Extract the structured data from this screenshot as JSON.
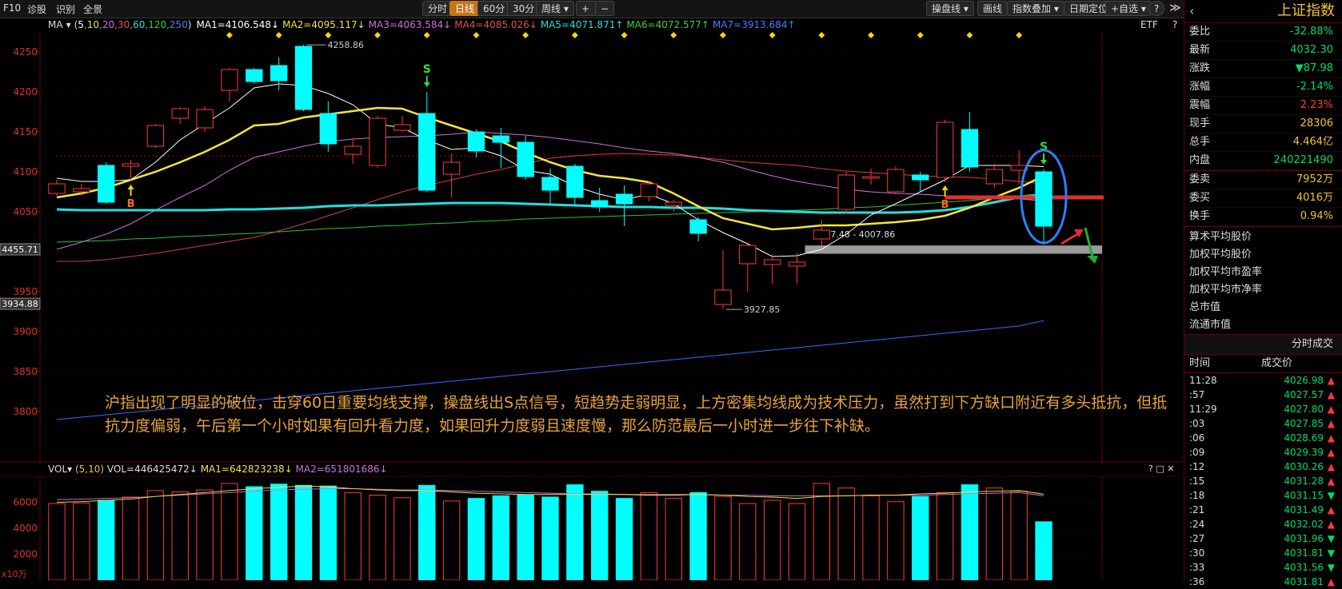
{
  "topbar": {
    "left_items": [
      "F10",
      "诊股",
      "识别",
      "全景"
    ],
    "period_buttons": [
      "分时",
      "日线",
      "60分",
      "30分",
      "周线 ▾"
    ],
    "active_period": "日线",
    "zoom_in": "+",
    "zoom_out": "−",
    "right_buttons": [
      "操盘线 ▾",
      "画线",
      "指数叠加 ▾",
      "日期定位",
      "+自选 ▾"
    ],
    "help": "?",
    "collapse": "≫"
  },
  "ma_info": {
    "label": "MA",
    "params_open": "(",
    "params": [
      "5",
      "10",
      "20",
      "30",
      "60",
      "120",
      "250"
    ],
    "params_close": ")",
    "items": [
      {
        "text": "MA1=4106.548↓",
        "color": "#ffffff"
      },
      {
        "text": "MA2=4095.117↓",
        "color": "#f1e33a"
      },
      {
        "text": "MA3=4063.584↓",
        "color": "#d070e0"
      },
      {
        "text": "MA4=4085.026↓",
        "color": "#e05050"
      },
      {
        "text": "MA5=4071.871↑",
        "color": "#20e0e0"
      },
      {
        "text": "MA6=4072.577↑",
        "color": "#40d040"
      },
      {
        "text": "MA7=3913.684↑",
        "color": "#4080ff"
      }
    ],
    "etf": "ETF",
    "help": "?"
  },
  "colors": {
    "up": "#ff3a3a",
    "down": "#00ffff",
    "ma5": "#ffffff",
    "ma10": "#f5e63a",
    "ma20": "#d070e0",
    "ma30": "#d04040",
    "ma60": "#20e0e0",
    "ma120": "#30c030",
    "ma250": "#2f6fff",
    "grid": "#500000",
    "annotation": "#e8a33a",
    "price_up": "#ff3a3a",
    "price_down": "#00dd66"
  },
  "chart_data": [
    {
      "type": "candlestick",
      "yticks": [
        3800,
        3850,
        3900,
        3950,
        4000,
        4050,
        4100,
        4150,
        4200,
        4250
      ],
      "ylim": [
        3775,
        4275
      ],
      "left_markers": [
        "4455.71",
        "3934.88"
      ],
      "candles": [
        {
          "o": 4073,
          "c": 4085,
          "h": 4090,
          "l": 4070
        },
        {
          "o": 4075,
          "c": 4079,
          "h": 4085,
          "l": 4070
        },
        {
          "o": 4108,
          "c": 4062,
          "h": 4112,
          "l": 4060
        },
        {
          "o": 4107,
          "c": 4110,
          "h": 4115,
          "l": 4088
        },
        {
          "o": 4132,
          "c": 4158,
          "h": 4160,
          "l": 4130
        },
        {
          "o": 4167,
          "c": 4179,
          "h": 4181,
          "l": 4160
        },
        {
          "o": 4155,
          "c": 4178,
          "h": 4182,
          "l": 4150
        },
        {
          "o": 4202,
          "c": 4228,
          "h": 4230,
          "l": 4188
        },
        {
          "o": 4228,
          "c": 4213,
          "h": 4230,
          "l": 4210
        },
        {
          "o": 4233,
          "c": 4214,
          "h": 4243,
          "l": 4202
        },
        {
          "o": 4257,
          "c": 4178,
          "h": 4258.86,
          "l": 4176
        },
        {
          "o": 4173,
          "c": 4135,
          "h": 4188,
          "l": 4125
        },
        {
          "o": 4122,
          "c": 4132,
          "h": 4142,
          "l": 4110
        },
        {
          "o": 4108,
          "c": 4167,
          "h": 4170,
          "l": 4105
        },
        {
          "o": 4152,
          "c": 4159,
          "h": 4170,
          "l": 4150
        },
        {
          "o": 4173,
          "c": 4077,
          "h": 4200,
          "l": 4075
        },
        {
          "o": 4097,
          "c": 4112,
          "h": 4123,
          "l": 4068
        },
        {
          "o": 4150,
          "c": 4126,
          "h": 4153,
          "l": 4118
        },
        {
          "o": 4145,
          "c": 4137,
          "h": 4155,
          "l": 4105
        },
        {
          "o": 4137,
          "c": 4094,
          "h": 4145,
          "l": 4090
        },
        {
          "o": 4093,
          "c": 4077,
          "h": 4104,
          "l": 4060
        },
        {
          "o": 4107,
          "c": 4068,
          "h": 4110,
          "l": 4058
        },
        {
          "o": 4064,
          "c": 4056,
          "h": 4080,
          "l": 4050
        },
        {
          "o": 4072,
          "c": 4060,
          "h": 4083,
          "l": 4032
        },
        {
          "o": 4069,
          "c": 4085,
          "h": 4088,
          "l": 4063
        },
        {
          "o": 4058,
          "c": 4062,
          "h": 4065,
          "l": 4050
        },
        {
          "o": 4040,
          "c": 4023,
          "h": 4043,
          "l": 4013
        },
        {
          "o": 3934,
          "c": 3952,
          "h": 4002,
          "l": 3927.85
        },
        {
          "o": 3985,
          "c": 4008,
          "h": 4010,
          "l": 3950
        },
        {
          "o": 3984,
          "c": 3990,
          "h": 3997,
          "l": 3960
        },
        {
          "o": 3982,
          "c": 3987,
          "h": 3998,
          "l": 3960
        },
        {
          "o": 4016,
          "c": 4027,
          "h": 4040,
          "l": 4007
        },
        {
          "o": 4053,
          "c": 4096,
          "h": 4100,
          "l": 4048
        },
        {
          "o": 4092,
          "c": 4094,
          "h": 4104,
          "l": 4084
        },
        {
          "o": 4075,
          "c": 4103,
          "h": 4107,
          "l": 4072
        },
        {
          "o": 4096,
          "c": 4090,
          "h": 4100,
          "l": 4075
        },
        {
          "o": 4093,
          "c": 4162,
          "h": 4165,
          "l": 4087
        },
        {
          "o": 4153,
          "c": 4106,
          "h": 4175,
          "l": 4100
        },
        {
          "o": 4085,
          "c": 4103,
          "h": 4110,
          "l": 4080
        },
        {
          "o": 4102,
          "c": 4108,
          "h": 4127,
          "l": 4085
        },
        {
          "o": 4100,
          "c": 4032,
          "h": 4103,
          "l": 4009
        }
      ],
      "ma10": [
        4068,
        4073,
        4080,
        4090,
        4100,
        4112,
        4125,
        4140,
        4158,
        4160,
        4168,
        4172,
        4176,
        4180,
        4179,
        4168,
        4158,
        4148,
        4138,
        4124,
        4112,
        4102,
        4095,
        4092,
        4087,
        4073,
        4057,
        4042,
        4035,
        4028,
        4030,
        4033,
        4033,
        4035,
        4037,
        4040,
        4045,
        4055,
        4068,
        4080,
        4095
      ],
      "ma5": [
        4092,
        4088,
        4088,
        4090,
        4112,
        4140,
        4160,
        4180,
        4205,
        4210,
        4208,
        4198,
        4184,
        4160,
        4155,
        4140,
        4128,
        4130,
        4120,
        4102,
        4097,
        4082,
        4072,
        4065,
        4072,
        4060,
        4040,
        4024,
        4010,
        3994,
        3995,
        4003,
        4022,
        4046,
        4060,
        4075,
        4090,
        4108,
        4108,
        4108,
        4106.5
      ],
      "ma20": [
        4003,
        4012,
        4022,
        4035,
        4052,
        4068,
        4083,
        4102,
        4118,
        4125,
        4132,
        4138,
        4141,
        4143,
        4144,
        4145,
        4147,
        4150,
        4148,
        4146,
        4143,
        4139,
        4135,
        4130,
        4126,
        4123,
        4118,
        4112,
        4103,
        4095,
        4088,
        4083,
        4078,
        4075,
        4073,
        4072,
        4070,
        4069,
        4068,
        4066,
        4063.6
      ],
      "ma30": [
        3988,
        3988,
        3990,
        3994,
        3998,
        4003,
        4008,
        4013,
        4018,
        4026,
        4035,
        4045,
        4055,
        4065,
        4075,
        4083,
        4090,
        4097,
        4103,
        4110,
        4117,
        4120,
        4122,
        4123,
        4122,
        4121,
        4118,
        4115,
        4112,
        4110,
        4108,
        4104,
        4101,
        4099,
        4097,
        4095,
        4094,
        4093,
        4091,
        4088,
        4085
      ],
      "ma60": [
        4053,
        4052,
        4052,
        4052,
        4052,
        4052,
        4052,
        4053,
        4053,
        4054,
        4055,
        4057,
        4058,
        4058,
        4059,
        4060,
        4061,
        4061,
        4061,
        4060,
        4059,
        4058,
        4057,
        4056,
        4056,
        4055,
        4055,
        4054,
        4052,
        4051,
        4050,
        4049,
        4049,
        4049,
        4049,
        4050,
        4052,
        4056,
        4062,
        4068,
        4072
      ],
      "ma120": [
        4012,
        4013,
        4014,
        4016,
        4017,
        4019,
        4020,
        4022,
        4023,
        4025,
        4027,
        4029,
        4030,
        4032,
        4033,
        4035,
        4036,
        4038,
        4039,
        4041,
        4042,
        4043,
        4044,
        4045,
        4046,
        4047,
        4048,
        4049,
        4050,
        4051,
        4052,
        4053,
        4055,
        4056,
        4058,
        4060,
        4062,
        4064,
        4067,
        4070,
        4072.6
      ],
      "ma250": [
        3790,
        3793,
        3796,
        3799,
        3802,
        3805,
        3808,
        3811,
        3814,
        3817,
        3820,
        3823,
        3826,
        3829,
        3832,
        3835,
        3838,
        3841,
        3844,
        3847,
        3850,
        3853,
        3856,
        3859,
        3862,
        3865,
        3868,
        3871,
        3874,
        3877,
        3880,
        3883,
        3886,
        3889,
        3892,
        3895,
        3898,
        3901,
        3904,
        3907,
        3913.7
      ],
      "annotations": {
        "high_label": "4258.86",
        "low_label": "3927.85",
        "gap_label": "3997.48 - 4007.86",
        "gap_range": [
          3997.48,
          4007.86
        ],
        "resistance_level": 4068,
        "b_signals": [
          3,
          36
        ],
        "s_signals": [
          15,
          40
        ],
        "b_text": "B",
        "s_text": "S"
      }
    },
    {
      "type": "bar",
      "name": "VOL",
      "yticks": [
        2000,
        4000,
        6000
      ],
      "unit_label": "x10万",
      "ylim": [
        0,
        8000
      ],
      "values": [
        5900,
        5950,
        6150,
        6400,
        6900,
        6800,
        6950,
        7450,
        7200,
        7400,
        7300,
        7250,
        6750,
        6550,
        6350,
        7300,
        6100,
        6300,
        6500,
        6550,
        6400,
        7350,
        6850,
        6300,
        6750,
        6300,
        6750,
        6450,
        5900,
        6150,
        5900,
        7450,
        7100,
        6500,
        6050,
        6450,
        6750,
        7350,
        7100,
        6850,
        4500
      ],
      "ma1": [
        6000,
        6050,
        6150,
        6250,
        6450,
        6600,
        6750,
        6900,
        7050,
        7150,
        7250,
        7200,
        7050,
        6950,
        6900,
        6900,
        6800,
        6700,
        6650,
        6600,
        6600,
        6600,
        6600,
        6600,
        6550,
        6550,
        6600,
        6550,
        6450,
        6400,
        6300,
        6450,
        6500,
        6550,
        6550,
        6650,
        6700,
        6800,
        6850,
        6900,
        6620
      ],
      "ma2": [
        6200,
        6250,
        6300,
        6350,
        6450,
        6550,
        6650,
        6750,
        6850,
        6950,
        7000,
        7050,
        7050,
        7000,
        6950,
        6950,
        6900,
        6850,
        6800,
        6750,
        6700,
        6650,
        6650,
        6600,
        6600,
        6600,
        6600,
        6550,
        6550,
        6500,
        6500,
        6500,
        6500,
        6550,
        6550,
        6550,
        6600,
        6650,
        6700,
        6750,
        6500
      ]
    }
  ],
  "vol_info": {
    "label": "VOL",
    "params": "(5,10)",
    "vol": "VOL=446425472↓",
    "ma1": "MA1=642823238↓",
    "ma2": "MA2=651801686↓",
    "icons": "? □ ✕"
  },
  "annotation_text": "沪指出现了明显的破位，击穿60日重要均线支撑，操盘线出S点信号，短趋势走弱明显，上方密集均线成为技术压力，虽然打到下方缺口附近有多头抵抗，但抵抗力度偏弱，午后第一个小时如果有回升看力度，如果回升力度弱且速度慢，那么防范最后一小时进一步往下补缺。",
  "rpanel": {
    "title": "上证指数",
    "back": "‹",
    "quote": [
      {
        "k": "委比",
        "v": "-32.88%",
        "c": "#00dd66"
      },
      {
        "k": "最新",
        "v": "4032.30",
        "c": "#00dd66"
      },
      {
        "k": "涨跌",
        "v": "▼87.98",
        "c": "#00dd66"
      },
      {
        "k": "涨幅",
        "v": "-2.14%",
        "c": "#00dd66"
      },
      {
        "k": "震幅",
        "v": "2.23%",
        "c": "#ff3a3a"
      },
      {
        "k": "现手",
        "v": "28306",
        "c": "#f1c232"
      },
      {
        "k": "总手",
        "v": "4.464亿",
        "c": "#f1c232"
      },
      {
        "k": "内盘",
        "v": "240221490",
        "c": "#00dd66"
      }
    ],
    "quote2": [
      {
        "k": "委卖",
        "v": "7952万",
        "c": "#f1c232"
      },
      {
        "k": "委买",
        "v": "4016万",
        "c": "#f1c232"
      },
      {
        "k": "换手",
        "v": "0.94%",
        "c": "#f1c232"
      }
    ],
    "stats": [
      "算术平均股价",
      "加权平均股价",
      "加权平均市盈率",
      "加权平均市净率",
      "总市值",
      "流通市值"
    ],
    "ticks_title": "分时成交",
    "ticks_col_time": "时间",
    "ticks_col_price": "成交价",
    "ticks": [
      {
        "t": "11:28",
        "p": "4026.98",
        "d": "▲",
        "c": "#ff3a3a"
      },
      {
        "t": ":57",
        "p": "4027.57",
        "d": "▲",
        "c": "#ff3a3a"
      },
      {
        "t": "11:29",
        "p": "4027.80",
        "d": "▲",
        "c": "#ff3a3a"
      },
      {
        "t": ":03",
        "p": "4027.85",
        "d": "▲",
        "c": "#ff3a3a"
      },
      {
        "t": ":06",
        "p": "4028.69",
        "d": "▲",
        "c": "#ff3a3a"
      },
      {
        "t": ":09",
        "p": "4029.39",
        "d": "▲",
        "c": "#ff3a3a"
      },
      {
        "t": ":12",
        "p": "4030.26",
        "d": "▲",
        "c": "#ff3a3a"
      },
      {
        "t": ":15",
        "p": "4031.28",
        "d": "▲",
        "c": "#ff3a3a"
      },
      {
        "t": ":18",
        "p": "4031.15",
        "d": "▼",
        "c": "#00dd66"
      },
      {
        "t": ":21",
        "p": "4031.49",
        "d": "▲",
        "c": "#ff3a3a"
      },
      {
        "t": ":24",
        "p": "4032.02",
        "d": "▲",
        "c": "#ff3a3a"
      },
      {
        "t": ":27",
        "p": "4031.96",
        "d": "▼",
        "c": "#00dd66"
      },
      {
        "t": ":30",
        "p": "4031.81",
        "d": "▼",
        "c": "#00dd66"
      },
      {
        "t": ":33",
        "p": "4031.56",
        "d": "▼",
        "c": "#00dd66"
      },
      {
        "t": ":36",
        "p": "4031.81",
        "d": "▲",
        "c": "#ff3a3a"
      }
    ]
  }
}
